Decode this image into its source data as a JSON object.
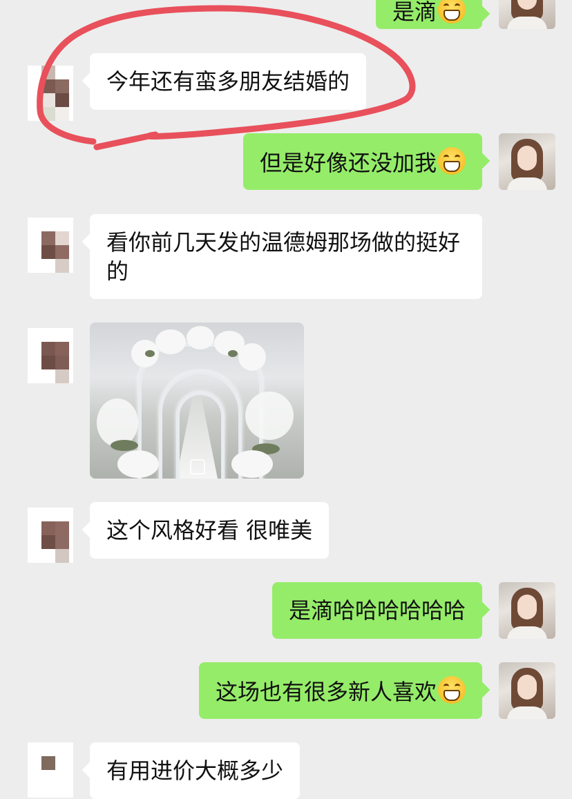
{
  "messages": [
    {
      "side": "out",
      "text": "是滴",
      "emoji": "grinning-face"
    },
    {
      "side": "in",
      "text": "今年还有蛮多朋友结婚的"
    },
    {
      "side": "out",
      "text": "但是好像还没加我",
      "emoji": "grinning-face"
    },
    {
      "side": "in",
      "text": "看你前几天发的温德姆那场做的挺好的"
    },
    {
      "side": "in",
      "type": "image",
      "image_description_icon": "wedding-hall-photo"
    },
    {
      "side": "in",
      "text": "这个风格好看 很唯美"
    },
    {
      "side": "out",
      "text": "是滴哈哈哈哈哈哈"
    },
    {
      "side": "out",
      "text": "这场也有很多新人喜欢",
      "emoji": "grinning-face"
    },
    {
      "side": "in",
      "text": "有用进价大概多少"
    }
  ],
  "colors": {
    "background": "#ededed",
    "incoming_bubble": "#ffffff",
    "outgoing_bubble": "#95ec69",
    "annotation_stroke": "#e8505b"
  },
  "icons": {
    "emoji": "grinning-face-icon",
    "photo_watermark": "watermark-logo-icon"
  }
}
